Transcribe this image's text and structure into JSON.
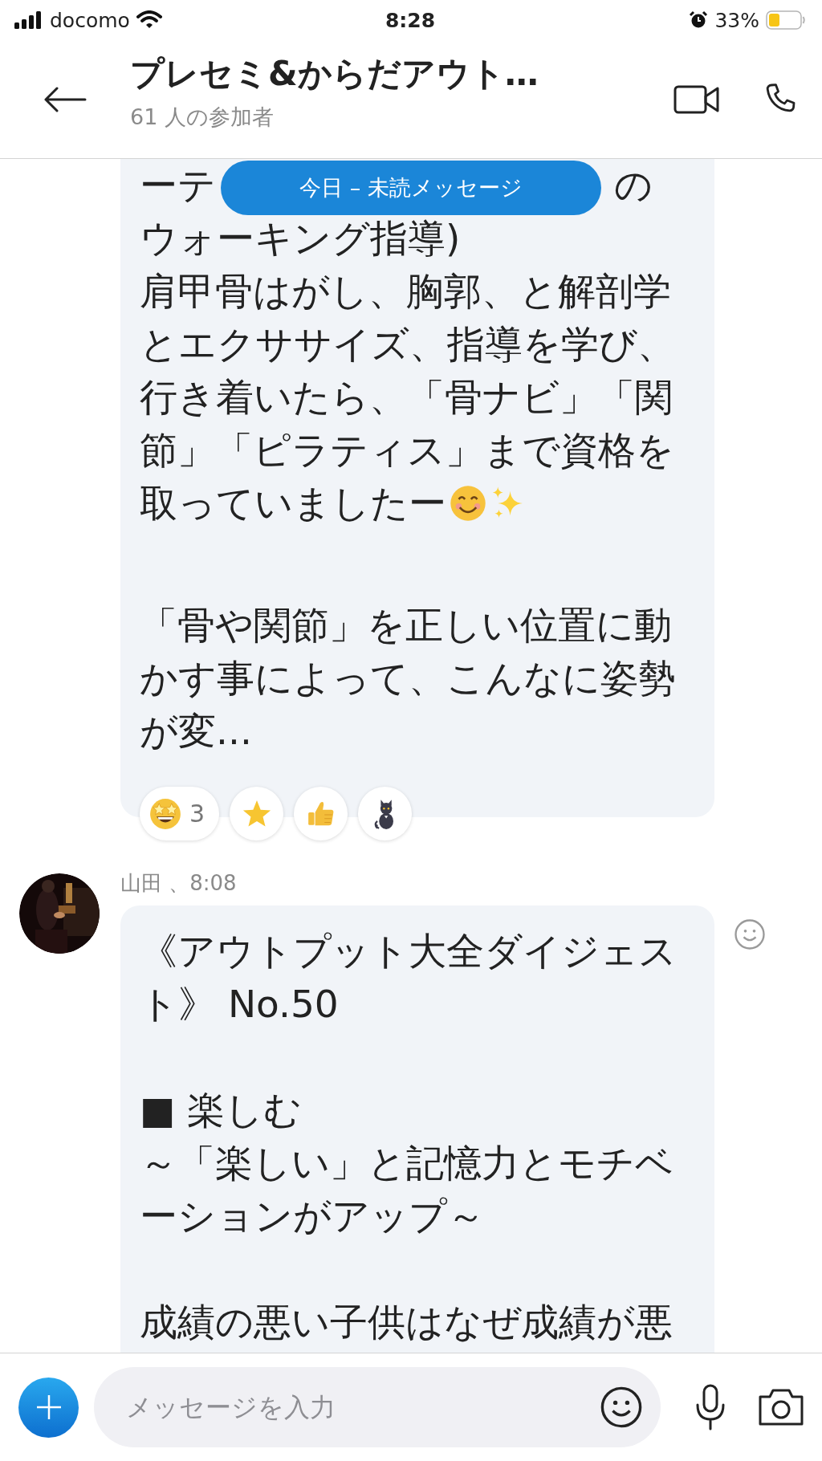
{
  "status_bar": {
    "carrier": "docomo",
    "time": "8:28",
    "battery": "33%"
  },
  "header": {
    "title": "プレセミ&からだアウト…",
    "subtitle": "61 人の参加者"
  },
  "unread_banner": "今日 – 未読メッセージ",
  "messages": [
    {
      "kind": "continued",
      "partial_line": [
        "ーテ",
        "の"
      ],
      "paragraphs": [
        {
          "kind": "emoji-end",
          "lines": [
            "ウォーキング指導)",
            "肩甲骨はがし、胸郭、と解剖学",
            "とエクササイズ、指導を学び、",
            "行き着いたら、「骨ナビ」「関",
            "節」「ピラティス」まで資格を",
            "取っていましたー"
          ]
        },
        {
          "kind": "plain",
          "lines": [
            "「骨や関節」を正しい位置に動",
            "かす事によって、こんなに姿勢",
            "が変..."
          ]
        }
      ],
      "reactions": [
        {
          "kind": "star-struck",
          "count": "3"
        },
        {
          "kind": "star"
        },
        {
          "kind": "thumbs-up"
        },
        {
          "kind": "cat"
        }
      ]
    },
    {
      "kind": "incoming",
      "avatar": {
        "kind": "picture"
      },
      "sender_line": "山田 、8:08",
      "paragraphs": [
        {
          "kind": "plain",
          "lines": [
            "《アウトプット大全ダイジェス",
            "ト》 No.50"
          ]
        },
        {
          "kind": "plain",
          "lines": [
            "■ 楽しむ",
            "～「楽しい」と記憶力とモチベ",
            "ーションがアップ～"
          ]
        },
        {
          "kind": "plain",
          "lines": [
            "成績の悪い子供はなぜ成績が悪"
          ]
        }
      ]
    }
  ],
  "composer": {
    "placeholder": "メッセージを入力"
  }
}
